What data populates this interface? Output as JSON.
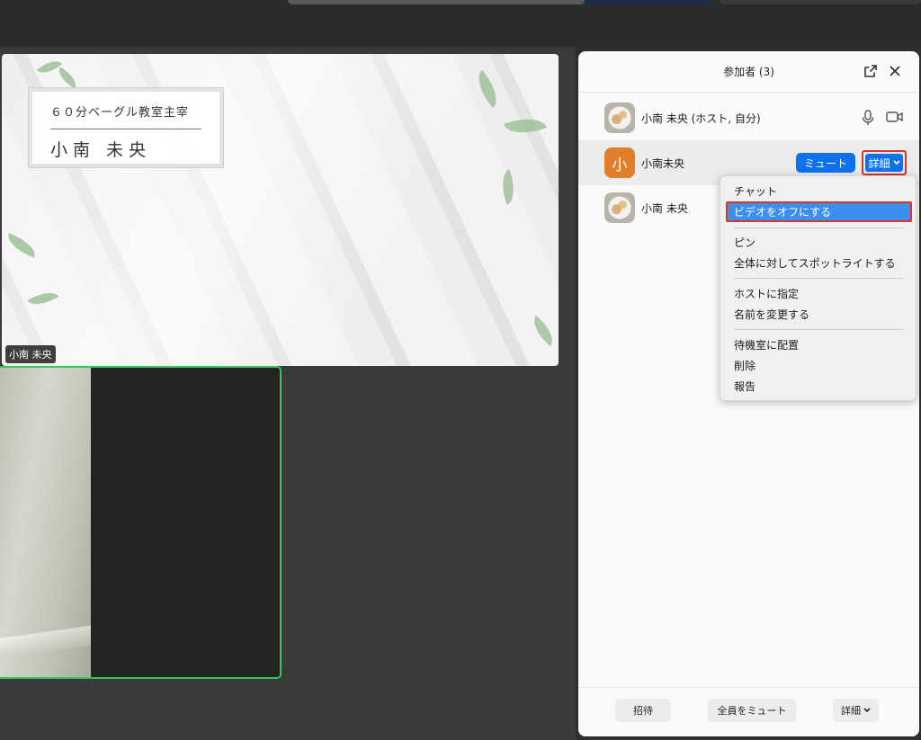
{
  "video": {
    "tile_1": {
      "card_subtitle": "６０分ベーグル教室主宰",
      "card_name": "小南 未央",
      "label": "小南 未央"
    }
  },
  "participants_panel": {
    "title": "参加者 (3)",
    "rows": [
      {
        "name": "小南 未央 (ホスト, 自分)"
      },
      {
        "initial": "小",
        "name": "小南未央",
        "mute_label": "ミュート",
        "more_label": "詳細"
      },
      {
        "name": "小南 未央"
      }
    ],
    "footer": {
      "invite_label": "招待",
      "mute_all_label": "全員をミュート",
      "more_label": "詳細"
    }
  },
  "context_menu": {
    "items": [
      "チャット",
      "ビデオをオフにする",
      "ピン",
      "全体に対してスポットライトする",
      "ホストに指定",
      "名前を変更する",
      "待機室に配置",
      "削除",
      "報告"
    ],
    "selected_index": 1
  },
  "colors": {
    "accent_blue": "#0e72ed",
    "highlight_red": "#d9352b",
    "active_speaker_green": "#34c759",
    "avatar_orange": "#e07e2a"
  }
}
